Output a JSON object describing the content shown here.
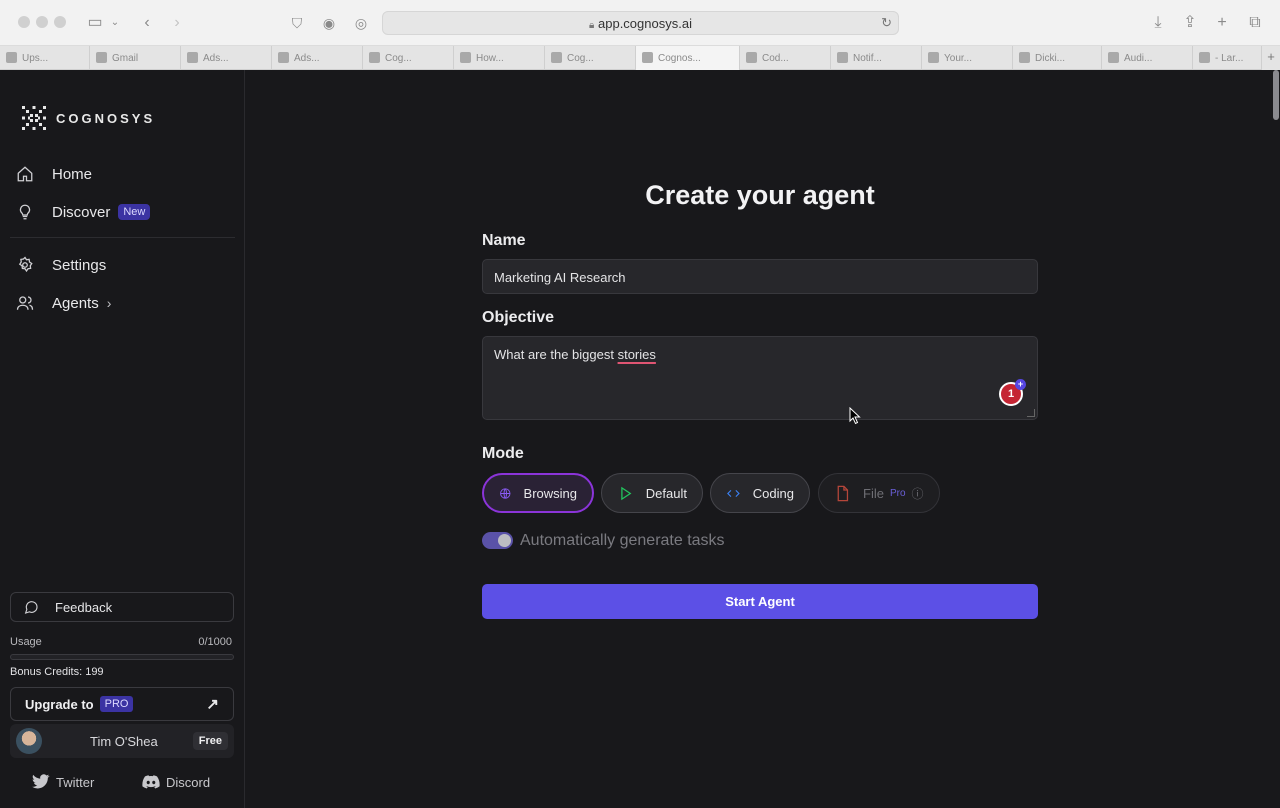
{
  "browser": {
    "url": "app.cognosys.ai",
    "tabs": [
      {
        "label": "Ups..."
      },
      {
        "label": "Gmail"
      },
      {
        "label": "Ads..."
      },
      {
        "label": "Ads..."
      },
      {
        "label": "Cog..."
      },
      {
        "label": "How..."
      },
      {
        "label": "Cog..."
      },
      {
        "label": "Cognos..."
      },
      {
        "label": "Cod..."
      },
      {
        "label": "Notif..."
      },
      {
        "label": "Your..."
      },
      {
        "label": "Dicki..."
      },
      {
        "label": "Audi..."
      },
      {
        "label": "- Lar..."
      }
    ]
  },
  "sidebar": {
    "logo_text": "COGNOSYS",
    "nav": {
      "home": "Home",
      "discover": "Discover",
      "discover_badge": "New",
      "settings": "Settings",
      "agents": "Agents"
    },
    "feedback": "Feedback",
    "usage_label": "Usage",
    "usage_value": "0/1000",
    "usage_fraction": 0,
    "bonus_credits": "Bonus Credits: 199",
    "upgrade_label": "Upgrade to",
    "upgrade_badge": "PRO",
    "user_name": "Tim O'Shea",
    "user_plan": "Free",
    "twitter": "Twitter",
    "discord": "Discord"
  },
  "form": {
    "title": "Create your agent",
    "name_label": "Name",
    "name_value": "Marketing AI Research",
    "objective_label": "Objective",
    "objective_prefix": "What are the biggest ",
    "objective_underlined": "stories",
    "grammar_count": "1",
    "mode_label": "Mode",
    "modes": {
      "browsing": "Browsing",
      "default": "Default",
      "coding": "Coding",
      "file": "File",
      "file_badge": "Pro"
    },
    "auto_tasks_label": "Automatically generate tasks",
    "start_button": "Start Agent"
  },
  "colors": {
    "accent": "#5c50e6",
    "selected_border": "#8b34d9",
    "background": "#18181b"
  }
}
